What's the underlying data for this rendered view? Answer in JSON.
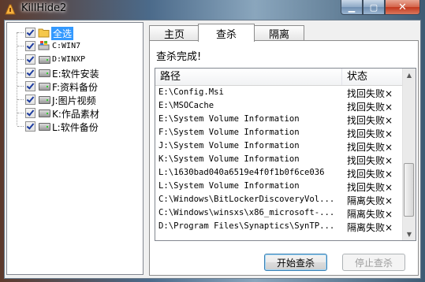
{
  "window": {
    "title": "KillHide2"
  },
  "sidebar": {
    "items": [
      {
        "label": "全选",
        "icon": "folder-icon",
        "selected": true
      },
      {
        "label": "C:WIN7",
        "icon": "drive-windows-icon"
      },
      {
        "label": "D:WINXP",
        "icon": "drive-icon"
      },
      {
        "label": "E:软件安装",
        "icon": "drive-icon"
      },
      {
        "label": "F:资料备份",
        "icon": "drive-icon"
      },
      {
        "label": "J:图片视频",
        "icon": "drive-icon"
      },
      {
        "label": "K:作品素材",
        "icon": "drive-icon"
      },
      {
        "label": "L:软件备份",
        "icon": "drive-icon"
      }
    ]
  },
  "tabs": [
    {
      "label": "主页"
    },
    {
      "label": "查杀",
      "active": true
    },
    {
      "label": "隔离"
    }
  ],
  "main": {
    "status": "查杀完成!",
    "columns": [
      "路径",
      "状态"
    ],
    "rows": [
      {
        "path": "E:\\Config.Msi",
        "status": "找回失败×"
      },
      {
        "path": "E:\\MSOCache",
        "status": "找回失败×"
      },
      {
        "path": "E:\\System Volume Information",
        "status": "找回失败×"
      },
      {
        "path": "F:\\System Volume Information",
        "status": "找回失败×"
      },
      {
        "path": "J:\\System Volume Information",
        "status": "找回失败×"
      },
      {
        "path": "K:\\System Volume Information",
        "status": "找回失败×"
      },
      {
        "path": "L:\\1630bad040a6519e4f0f1b0f6ce036",
        "status": "找回失败×"
      },
      {
        "path": "L:\\System Volume Information",
        "status": "找回失败×"
      },
      {
        "path": "C:\\Windows\\BitLockerDiscoveryVol...",
        "status": "隔离失败×"
      },
      {
        "path": "C:\\Windows\\winsxs\\x86_microsoft-...",
        "status": "隔离失败×"
      },
      {
        "path": "D:\\Program Files\\Synaptics\\SynTP...",
        "status": "隔离失败×"
      }
    ]
  },
  "buttons": {
    "start": "开始查杀",
    "stop": "停止查杀"
  },
  "colors": {
    "selection": "#3399ff",
    "close": "#c2381d"
  }
}
